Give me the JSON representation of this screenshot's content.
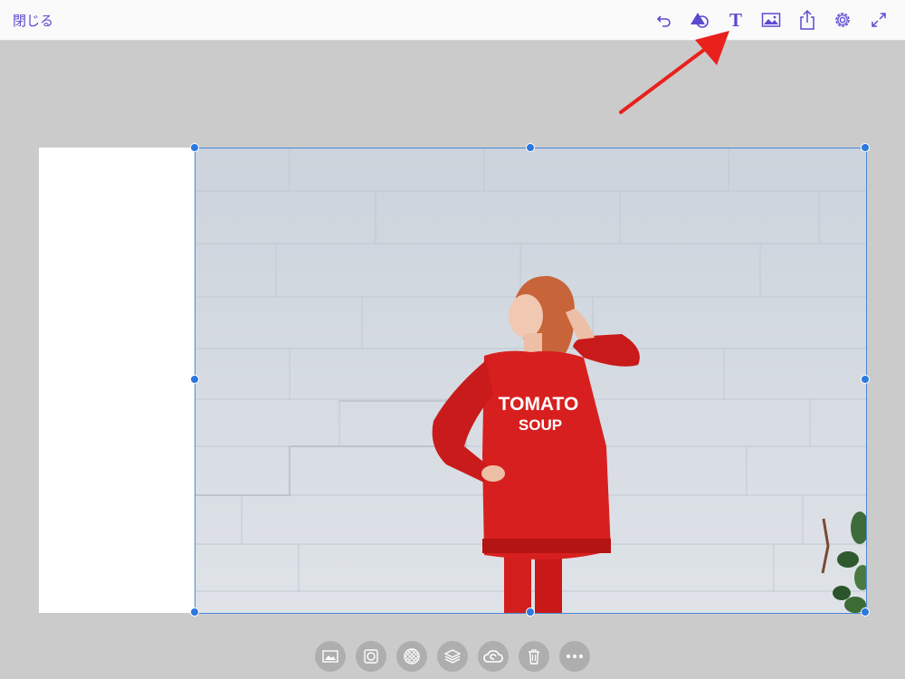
{
  "topbar": {
    "close_label": "閉じる",
    "tools": [
      {
        "name": "undo-icon"
      },
      {
        "name": "shapes-icon"
      },
      {
        "name": "text-tool-icon",
        "glyph": "T"
      },
      {
        "name": "image-icon"
      },
      {
        "name": "share-icon"
      },
      {
        "name": "settings-gear-icon"
      },
      {
        "name": "fullscreen-icon"
      }
    ],
    "accent_color": "#5a4ad1"
  },
  "canvas": {
    "photo": {
      "sweatshirt_line1": "TOMATO",
      "sweatshirt_line2": "SOUP"
    },
    "selection_color": "#2d78e0"
  },
  "bottom_toolbar": {
    "tools": [
      {
        "name": "replace-image-icon"
      },
      {
        "name": "crop-icon"
      },
      {
        "name": "transparency-icon"
      },
      {
        "name": "layers-icon"
      },
      {
        "name": "creative-cloud-icon"
      },
      {
        "name": "trash-icon"
      },
      {
        "name": "more-options-icon"
      }
    ]
  },
  "annotation": {
    "color": "#e8211c",
    "points_to": "text-tool-icon"
  }
}
